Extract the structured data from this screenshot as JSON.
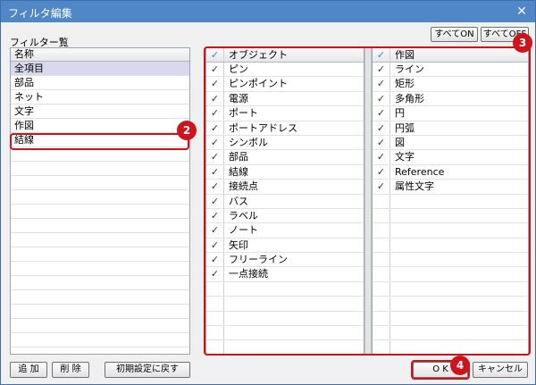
{
  "window": {
    "title": "フィルタ編集",
    "close_glyph": "✕"
  },
  "filter_list": {
    "label": "フィルター覧",
    "header": "名称",
    "items": [
      "全項目",
      "部品",
      "ネット",
      "文字",
      "作図",
      "結線"
    ],
    "selected_item": "全項目"
  },
  "toolbar": {
    "all_on": "すべてON",
    "all_off": "すべてOFF"
  },
  "objects_table": {
    "header": "オブジェクト",
    "header_check": "✓",
    "rows": [
      {
        "label": "ピン",
        "check": "✓"
      },
      {
        "label": "ピンポイント",
        "check": "✓"
      },
      {
        "label": "電源",
        "check": "✓"
      },
      {
        "label": "ポート",
        "check": "✓"
      },
      {
        "label": "ポートアドレス",
        "check": "✓"
      },
      {
        "label": "シンボル",
        "check": "✓"
      },
      {
        "label": "部品",
        "check": "✓"
      },
      {
        "label": "結線",
        "check": "✓"
      },
      {
        "label": "接続点",
        "check": "✓"
      },
      {
        "label": "バス",
        "check": "✓"
      },
      {
        "label": "ラベル",
        "check": "✓"
      },
      {
        "label": "ノート",
        "check": "✓"
      },
      {
        "label": "矢印",
        "check": "✓"
      },
      {
        "label": "フリーライン",
        "check": "✓"
      },
      {
        "label": "一点接続",
        "check": "✓"
      }
    ]
  },
  "drawing_table": {
    "header": "作図",
    "header_check": "✓",
    "rows": [
      {
        "label": "ライン",
        "check": "✓"
      },
      {
        "label": "矩形",
        "check": "✓"
      },
      {
        "label": "多角形",
        "check": "✓"
      },
      {
        "label": "円",
        "check": "✓"
      },
      {
        "label": "円弧",
        "check": "✓"
      },
      {
        "label": "図",
        "check": "✓"
      },
      {
        "label": "文字",
        "check": "✓"
      },
      {
        "label": "Reference",
        "check": "✓"
      },
      {
        "label": "属性文字",
        "check": "✓"
      }
    ]
  },
  "bottom_buttons": {
    "add": "追 加",
    "delete": "削 除",
    "reset": "初期設定に戻す",
    "ok": "O K",
    "cancel": "キャンセル"
  },
  "annotations": {
    "badge2": "2",
    "badge3": "3",
    "badge4": "4"
  },
  "colors": {
    "accent": "#d0121b",
    "titlebar": "#4f87c7"
  }
}
